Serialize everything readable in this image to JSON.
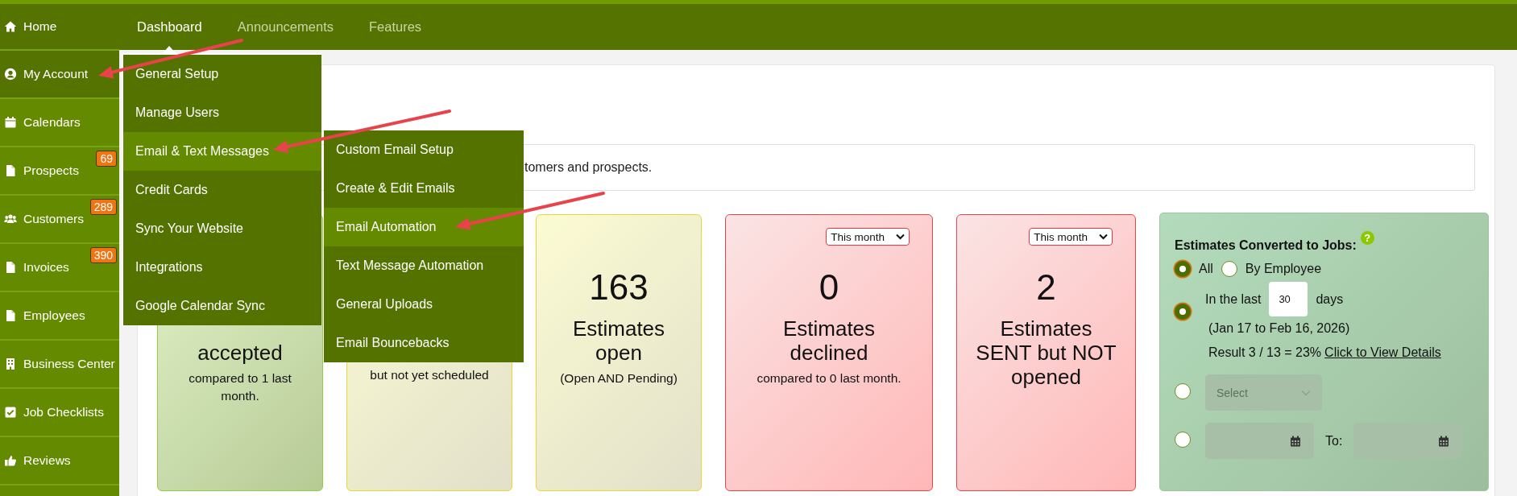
{
  "sidebar": {
    "items": [
      {
        "label": "Home",
        "highlighted": true
      },
      {
        "label": "My Account",
        "highlighted": true
      },
      {
        "label": "Calendars",
        "highlighted": false
      },
      {
        "label": "Prospects",
        "highlighted": false,
        "badge": "69"
      },
      {
        "label": "Customers",
        "highlighted": false,
        "badge": "289"
      },
      {
        "label": "Invoices",
        "highlighted": false,
        "badge": "390"
      },
      {
        "label": "Employees",
        "highlighted": false
      },
      {
        "label": "Business Center",
        "highlighted": false
      },
      {
        "label": "Job Checklists",
        "highlighted": false
      },
      {
        "label": "Reviews",
        "highlighted": false
      }
    ]
  },
  "nav": {
    "tabs": [
      {
        "label": "Dashboard",
        "selected": true
      },
      {
        "label": "Announcements",
        "selected": false
      },
      {
        "label": "Features",
        "selected": false
      }
    ]
  },
  "dropdown_menu": {
    "items": [
      {
        "label": "General Setup",
        "selected": false
      },
      {
        "label": "Manage Users",
        "selected": false
      },
      {
        "label": "Email & Text Messages",
        "selected": true
      },
      {
        "label": "Credit Cards",
        "selected": false
      },
      {
        "label": "Sync Your Website",
        "selected": false
      },
      {
        "label": "Integrations",
        "selected": false
      },
      {
        "label": "Google Calendar Sync",
        "selected": false
      }
    ]
  },
  "submenu": {
    "items": [
      {
        "label": "Custom Email Setup",
        "selected": false
      },
      {
        "label": "Create & Edit Emails",
        "selected": false
      },
      {
        "label": "Email Automation",
        "selected": true
      },
      {
        "label": "Text Message Automation",
        "selected": false
      },
      {
        "label": "General Uploads",
        "selected": false
      },
      {
        "label": "Email Bouncebacks",
        "selected": false
      }
    ]
  },
  "info_banner": {
    "text": "tomers and prospects."
  },
  "stat_cards": [
    {
      "kind": "success",
      "title": [
        "accepted"
      ],
      "subtitle": "compared to 1 last month."
    },
    {
      "kind": "warning",
      "subtitle": "but not yet scheduled"
    },
    {
      "kind": "warning",
      "number": "163",
      "title": [
        "Estimates",
        "open"
      ],
      "subtitle": "(Open AND Pending)"
    },
    {
      "kind": "danger",
      "period": "This month",
      "number": "0",
      "title": [
        "Estimates",
        "declined"
      ],
      "subtitle": "compared to 0 last month."
    },
    {
      "kind": "danger",
      "period": "This month",
      "number": "2",
      "title": [
        "Estimates",
        "SENT but NOT",
        "opened"
      ]
    }
  ],
  "conversion_panel": {
    "title": "Estimates Converted to Jobs:",
    "help": "?",
    "scope_options": [
      {
        "label": "All",
        "selected": true
      },
      {
        "label": "By Employee",
        "selected": false
      }
    ],
    "range_options": [
      {
        "kind": "last-days",
        "selected": true,
        "prefix": "In the last",
        "value": "30",
        "suffix": "days",
        "date_range": "(Jan 17 to Feb 16, 2026)",
        "result": "Result 3 / 13 = 23%",
        "link": "Click to View Details"
      },
      {
        "kind": "employee-select",
        "selected": false,
        "placeholder": "Select"
      },
      {
        "kind": "date-range",
        "selected": false,
        "separator": "To:"
      }
    ]
  }
}
